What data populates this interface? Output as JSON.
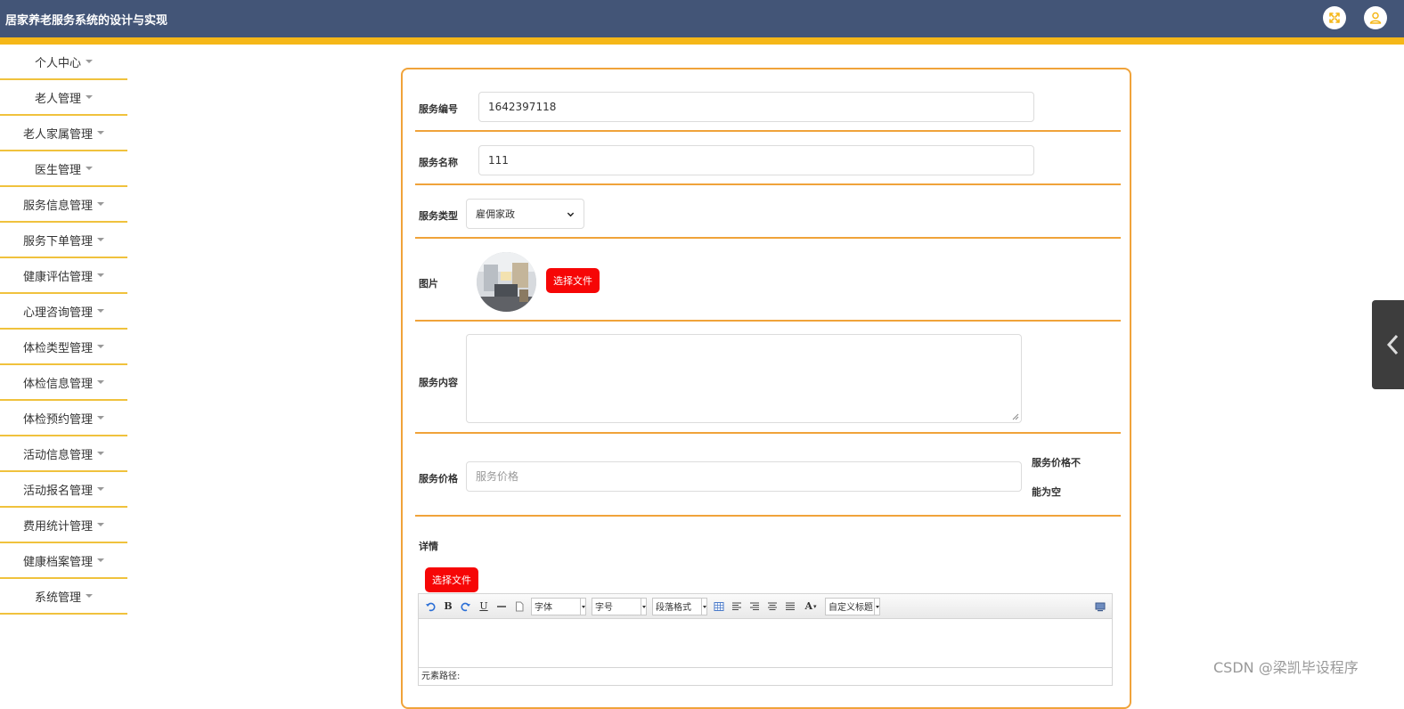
{
  "header": {
    "title": "居家养老服务系统的设计与实现",
    "fullscreen_icon": "fullscreen-icon",
    "user_icon": "user-icon"
  },
  "sidebar": {
    "items": [
      {
        "label": "个人中心"
      },
      {
        "label": "老人管理"
      },
      {
        "label": "老人家属管理"
      },
      {
        "label": "医生管理"
      },
      {
        "label": "服务信息管理"
      },
      {
        "label": "服务下单管理"
      },
      {
        "label": "健康评估管理"
      },
      {
        "label": "心理咨询管理"
      },
      {
        "label": "体检类型管理"
      },
      {
        "label": "体检信息管理"
      },
      {
        "label": "体检预约管理"
      },
      {
        "label": "活动信息管理"
      },
      {
        "label": "活动报名管理"
      },
      {
        "label": "费用统计管理"
      },
      {
        "label": "健康档案管理"
      },
      {
        "label": "系统管理"
      }
    ]
  },
  "form": {
    "service_no": {
      "label": "服务编号",
      "value": "1642397118"
    },
    "service_name": {
      "label": "服务名称",
      "value": "111"
    },
    "service_type": {
      "label": "服务类型",
      "value": "雇佣家政"
    },
    "image": {
      "label": "图片",
      "button": "选择文件"
    },
    "content": {
      "label": "服务内容",
      "value": ""
    },
    "price": {
      "label": "服务价格",
      "placeholder": "服务价格",
      "error_line1": "服务价格不",
      "error_line2": "能为空"
    },
    "details": {
      "label": "详情",
      "button": "选择文件",
      "toolbar": {
        "font": "字体",
        "size": "字号",
        "paragraph": "段落格式",
        "custom_title": "自定义标题"
      },
      "path_label": "元素路径:"
    }
  },
  "watermark": "CSDN @梁凯毕设程序",
  "colors": {
    "header_bg": "#435577",
    "accent_yellow": "#f5b718",
    "border_orange": "#f0a33a",
    "button_red": "#f60606"
  }
}
